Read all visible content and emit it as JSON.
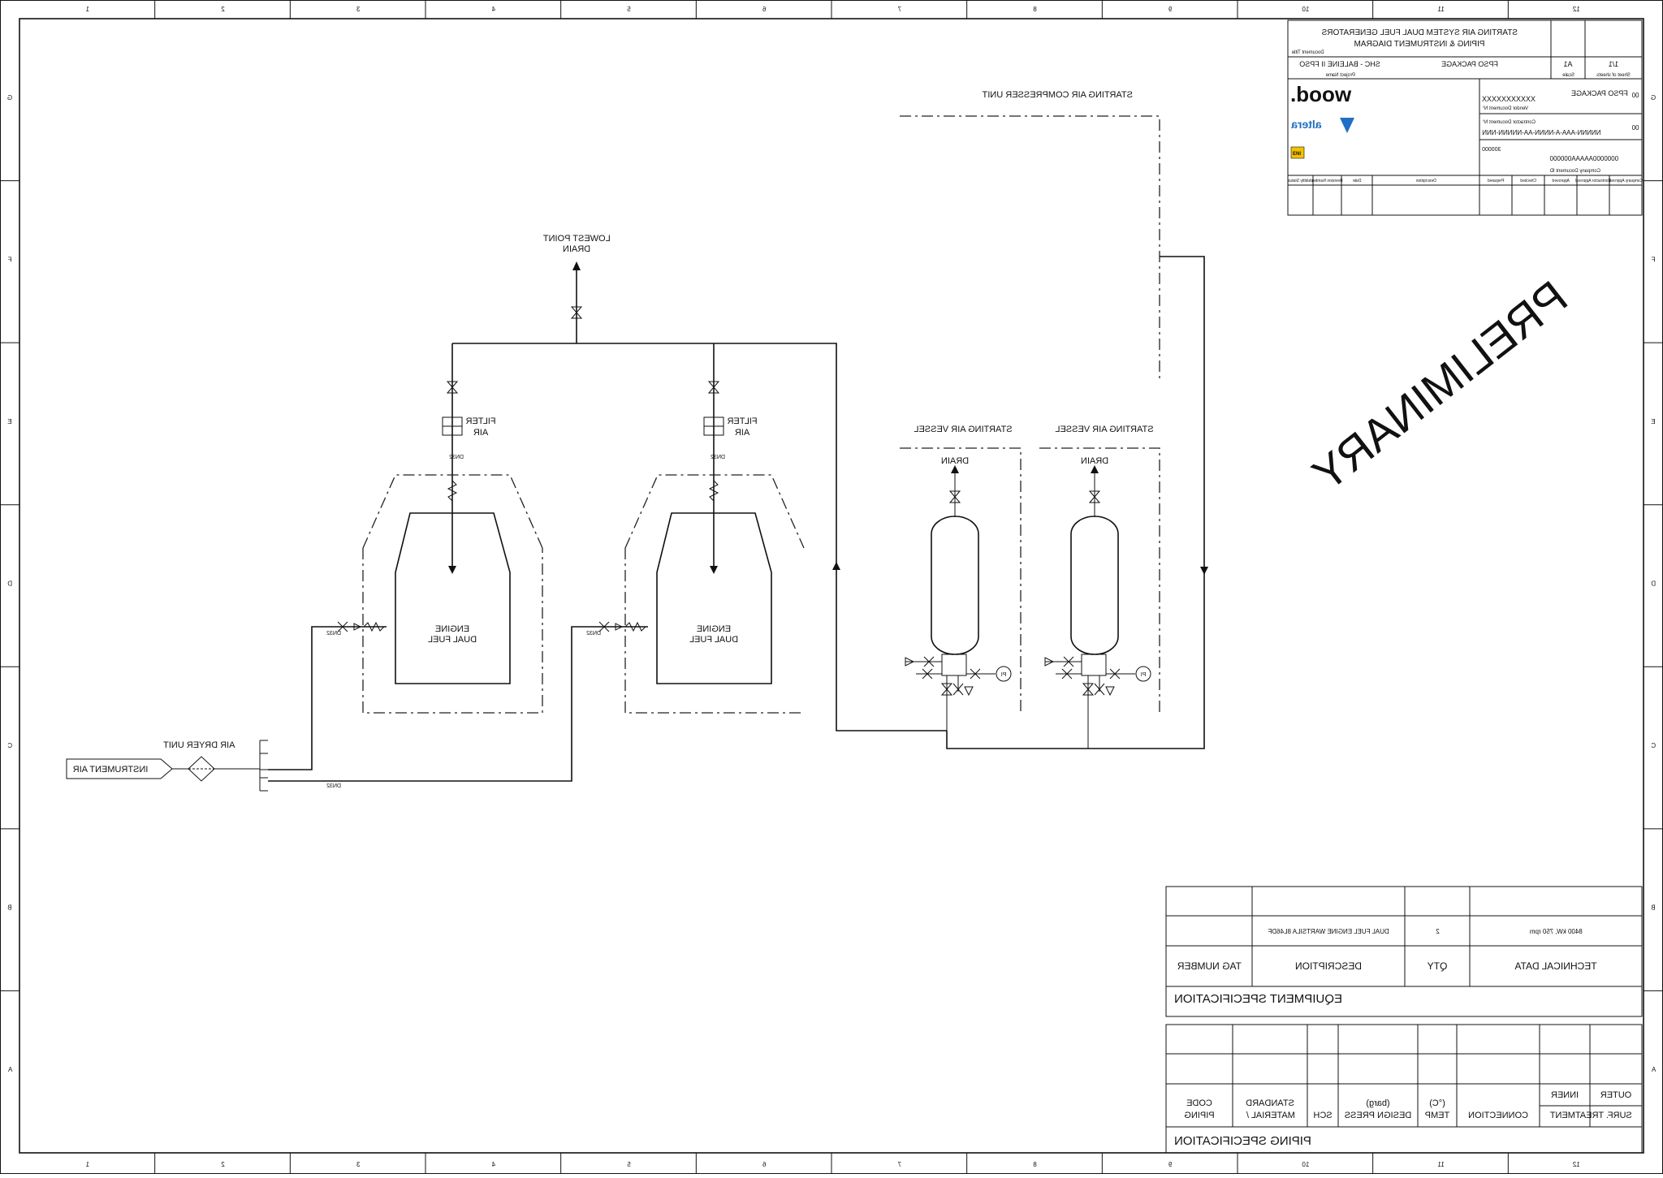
{
  "frame": {
    "col_marks": [
      "1",
      "2",
      "3",
      "4",
      "5",
      "6",
      "7",
      "8",
      "9",
      "10",
      "11",
      "12"
    ],
    "row_marks": [
      "A",
      "B",
      "C",
      "D",
      "E",
      "F",
      "G"
    ]
  },
  "title_block": {
    "title_line1": "STARTING AIR SYSTEM DUAL FUEL GENERATORS",
    "title_line2": "PIPING & INSTRUMENT DIAGRAM",
    "project": "SHC - BALEINE II FPSO",
    "package": "FPSO PACKAGE",
    "size": "A1",
    "sheet": "1/1",
    "contractor_brand": "wood.",
    "contractor_doc_no": "XXXXXXXXXXX",
    "contractor_subtitle": "FPSO PACKAGE",
    "rev_a": "00",
    "partner_brand": "altera",
    "partner_doc_no": "NNNNN-AAA-A-NNNN-AA-NNNNN-NNN",
    "rev_b": "00",
    "job_code": "300000",
    "company_doc_no": "0000000AAAAA000000",
    "owner_code": "ENI",
    "small_labels": {
      "doc_title": "Document Title",
      "project_field": "Project Name",
      "vendor_doc": "Vendor Document N°",
      "contractor_doc": "Contractor Document N°",
      "company_doc": "Company Document ID",
      "scale": "Scale",
      "sheet_of": "Sheet of sheets"
    },
    "revision_headers": [
      "Validity Status",
      "Revision Number",
      "Date",
      "Description",
      "Prepared",
      "Checked",
      "Approved",
      "Contractor Approval",
      "Company Approval"
    ]
  },
  "diagram": {
    "lowest_point_drain": "LOWEST POINT",
    "drain_word": "DRAIN",
    "compressor_unit": "STARTING AIR COMPRESSER UNIT",
    "preliminary": "PRELIMINARY",
    "air_filter_1": "AIR",
    "air_filter_1b": "FILTER",
    "air_filter_2": "AIR",
    "air_filter_2b": "FILTER",
    "engine_1_l1": "DUAL FUEL",
    "engine_1_l2": "ENGINE",
    "engine_2_l1": "DUAL FUEL",
    "engine_2_l2": "ENGINE",
    "vessel_1": "STARTING AIR VESSEL",
    "vessel_2": "STARTING AIR VESSEL",
    "vessel_1_drain": "DRAIN",
    "vessel_2_drain": "DRAIN",
    "pi_1": "PI",
    "pi_2": "PI",
    "instrument_air": "INSTRUMENT AIR",
    "air_dryer": "AIR DRYER UNIT",
    "line_a": "DN32",
    "line_b": "DN32",
    "line_c": "DN32",
    "line_d": "DN32",
    "line_e": "DN32",
    "line_f": "DN32"
  },
  "equipment_spec": {
    "heading": "EQUIPMENT SPECIFICATION",
    "headers": [
      "TAG NUMBER",
      "DESCRIPTION",
      "QTY",
      "TECHNICAL DATA"
    ],
    "row": [
      "",
      "DUAL FUEL ENGINE WARTSILA 8L46DF",
      "2",
      "8400 kW, 750 rpm"
    ]
  },
  "piping_spec": {
    "heading": "PIPING SPECIFICATION",
    "col_piping_l1": "PIPING",
    "col_piping_l2": "CODE",
    "col_material_l1": "MATERIAL /",
    "col_material_l2": "STANDARD",
    "col_sch": "SCH",
    "col_press_l1": "DESIGN PRESS",
    "col_press_l2": "(barg)",
    "col_temp_l1": "TEMP",
    "col_temp_l2": "(°C)",
    "col_conn": "CONNECTION",
    "col_surf": "SURF. TREATMENT",
    "col_inner": "INNER",
    "col_outer": "OUTER"
  }
}
